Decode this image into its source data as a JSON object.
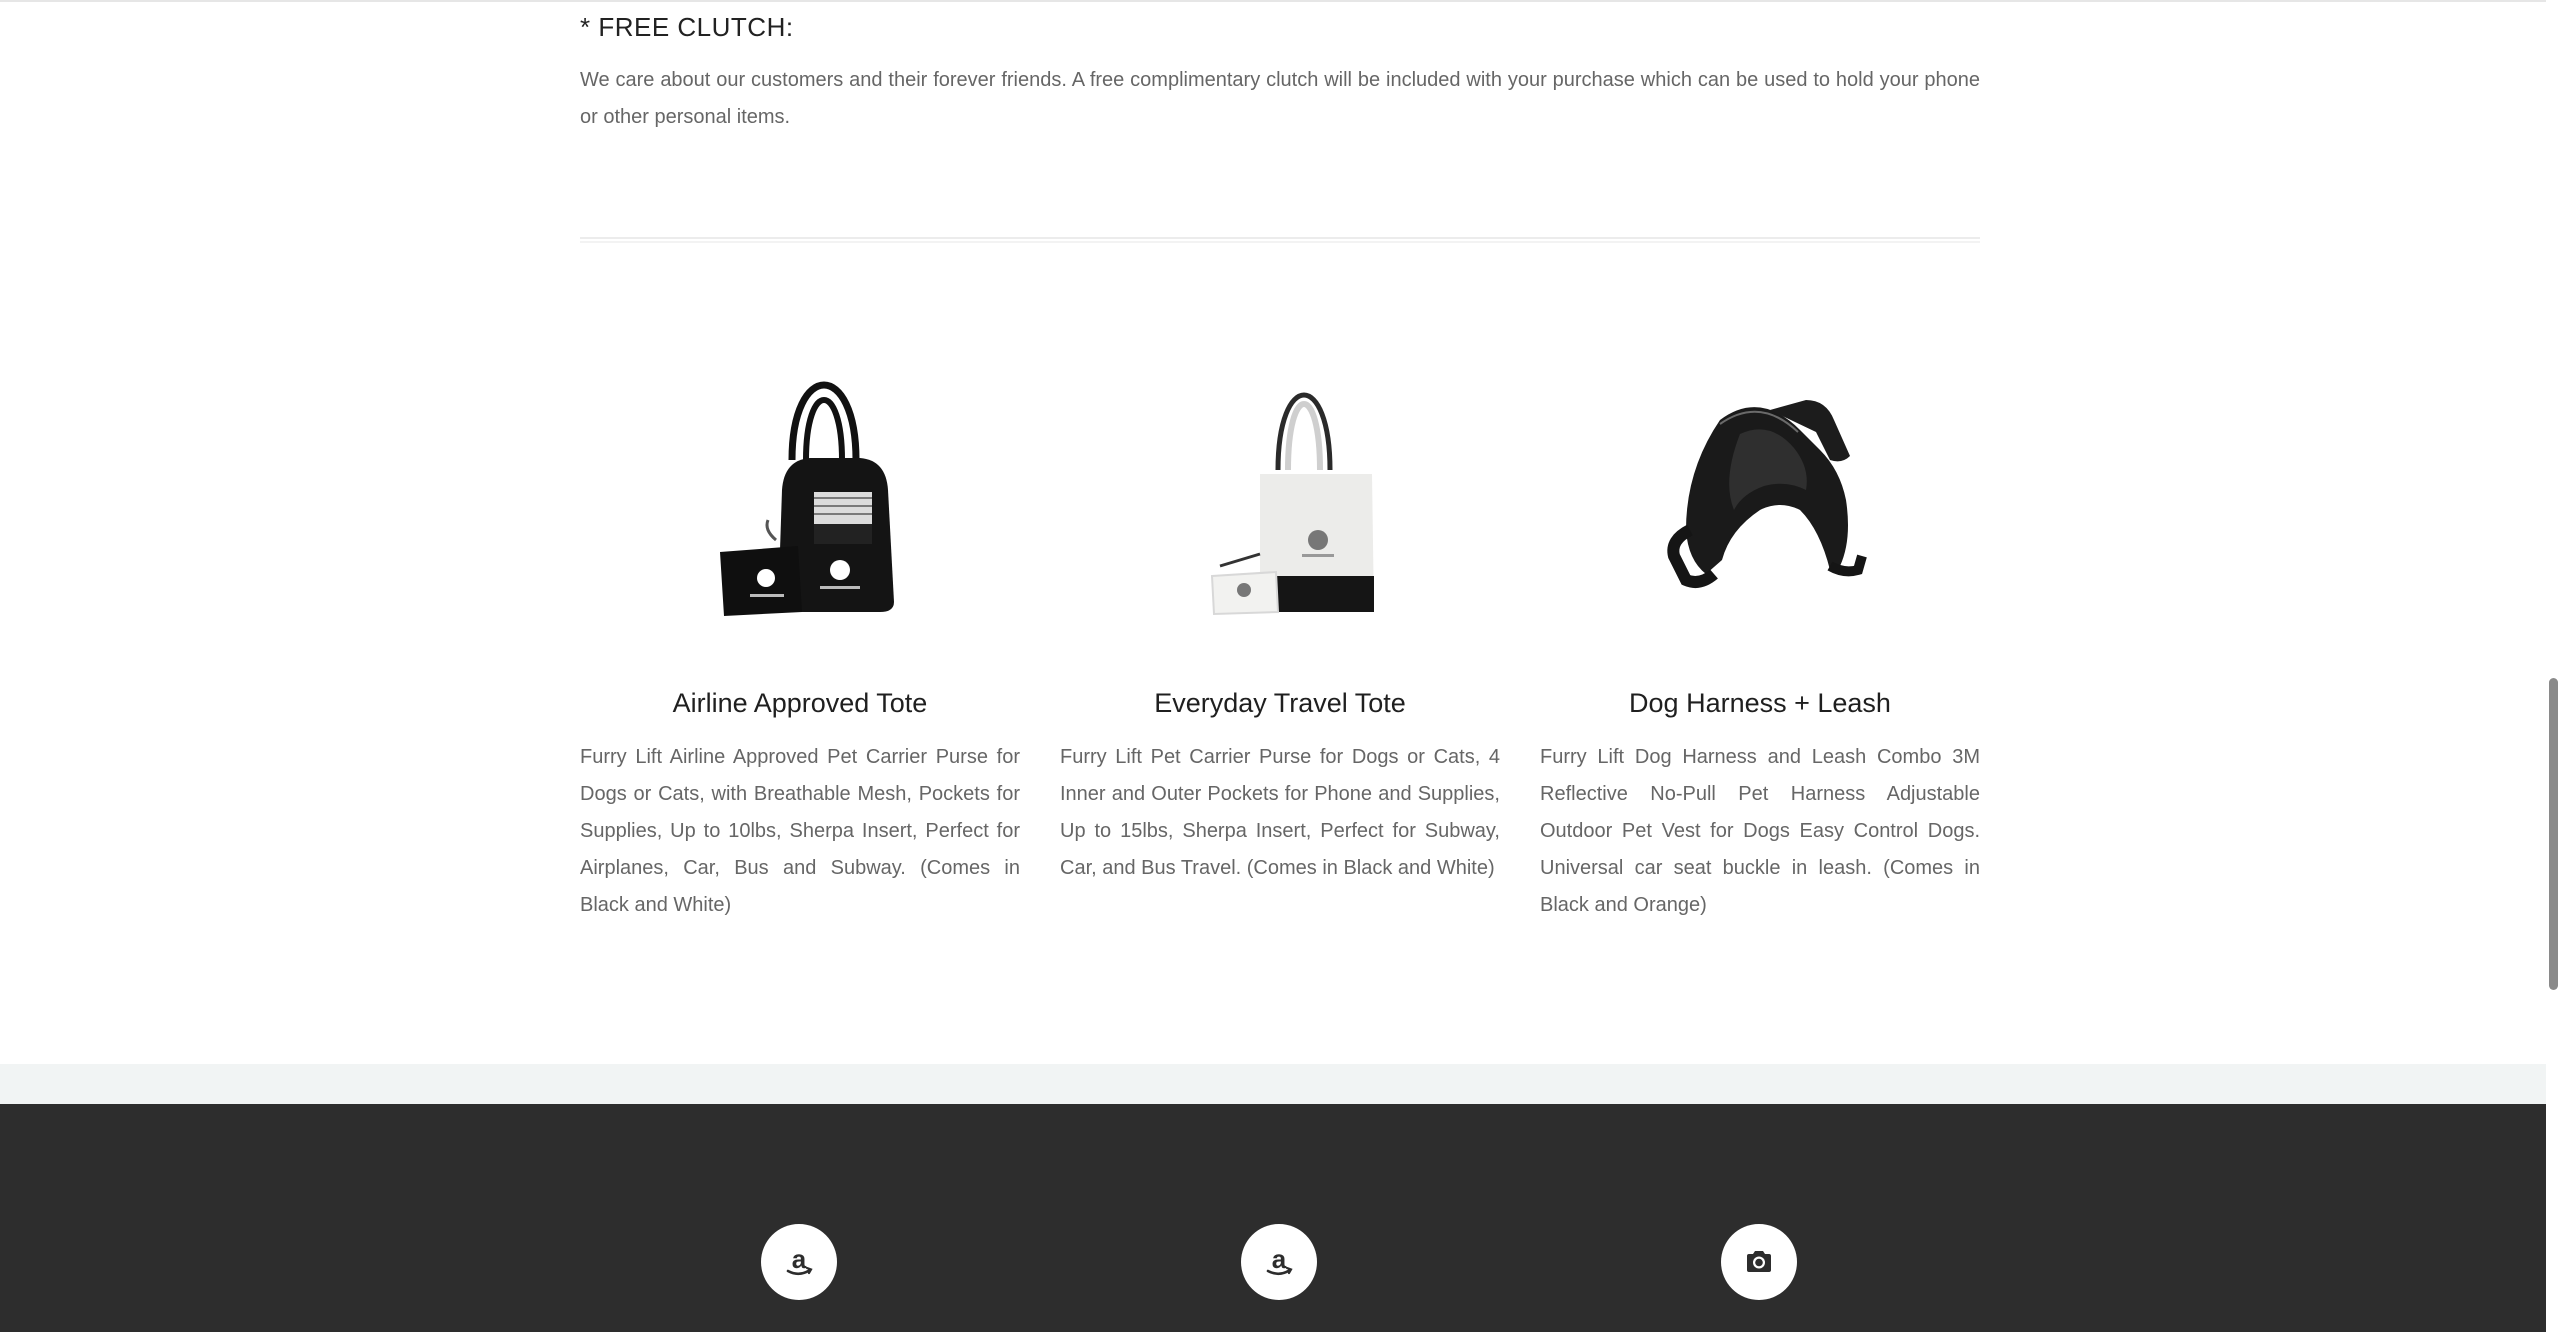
{
  "clutch": {
    "title": "* FREE CLUTCH:",
    "text": "We care about our customers and their forever friends. A free complimentary clutch will be included with your purchase which can be used to hold your phone or other personal items."
  },
  "products": [
    {
      "title": "Airline Approved Tote",
      "description": "Furry Lift Airline Approved Pet Carrier Purse for Dogs or Cats, with Breathable Mesh, Pockets for Supplies, Up to 10lbs, Sherpa Insert, Perfect for Airplanes, Car, Bus and Subway. (Comes in Black and White)",
      "image": "black-pet-carrier-tote"
    },
    {
      "title": "Everyday Travel Tote",
      "description": "Furry Lift Pet Carrier Purse for Dogs or Cats, 4 Inner and Outer Pockets for Phone and Supplies, Up to 15lbs, Sherpa Insert, Perfect for Subway, Car, and Bus Travel. (Comes in Black and White)",
      "image": "white-travel-tote"
    },
    {
      "title": "Dog Harness + Leash",
      "description": "Furry Lift Dog Harness and Leash Combo 3M Reflective No-Pull Pet Harness Adjustable Outdoor Pet Vest for Dogs Easy Control Dogs. Universal car seat buckle in leash. (Comes in Black and Orange)",
      "image": "black-dog-harness"
    }
  ],
  "footer": {
    "social": [
      {
        "icon": "amazon-icon"
      },
      {
        "icon": "amazon-icon"
      },
      {
        "icon": "camera-icon"
      }
    ]
  },
  "colors": {
    "footer_bg": "#2d2d2d",
    "footer_strip": "#f1f4f4",
    "text_gray": "#666666"
  }
}
